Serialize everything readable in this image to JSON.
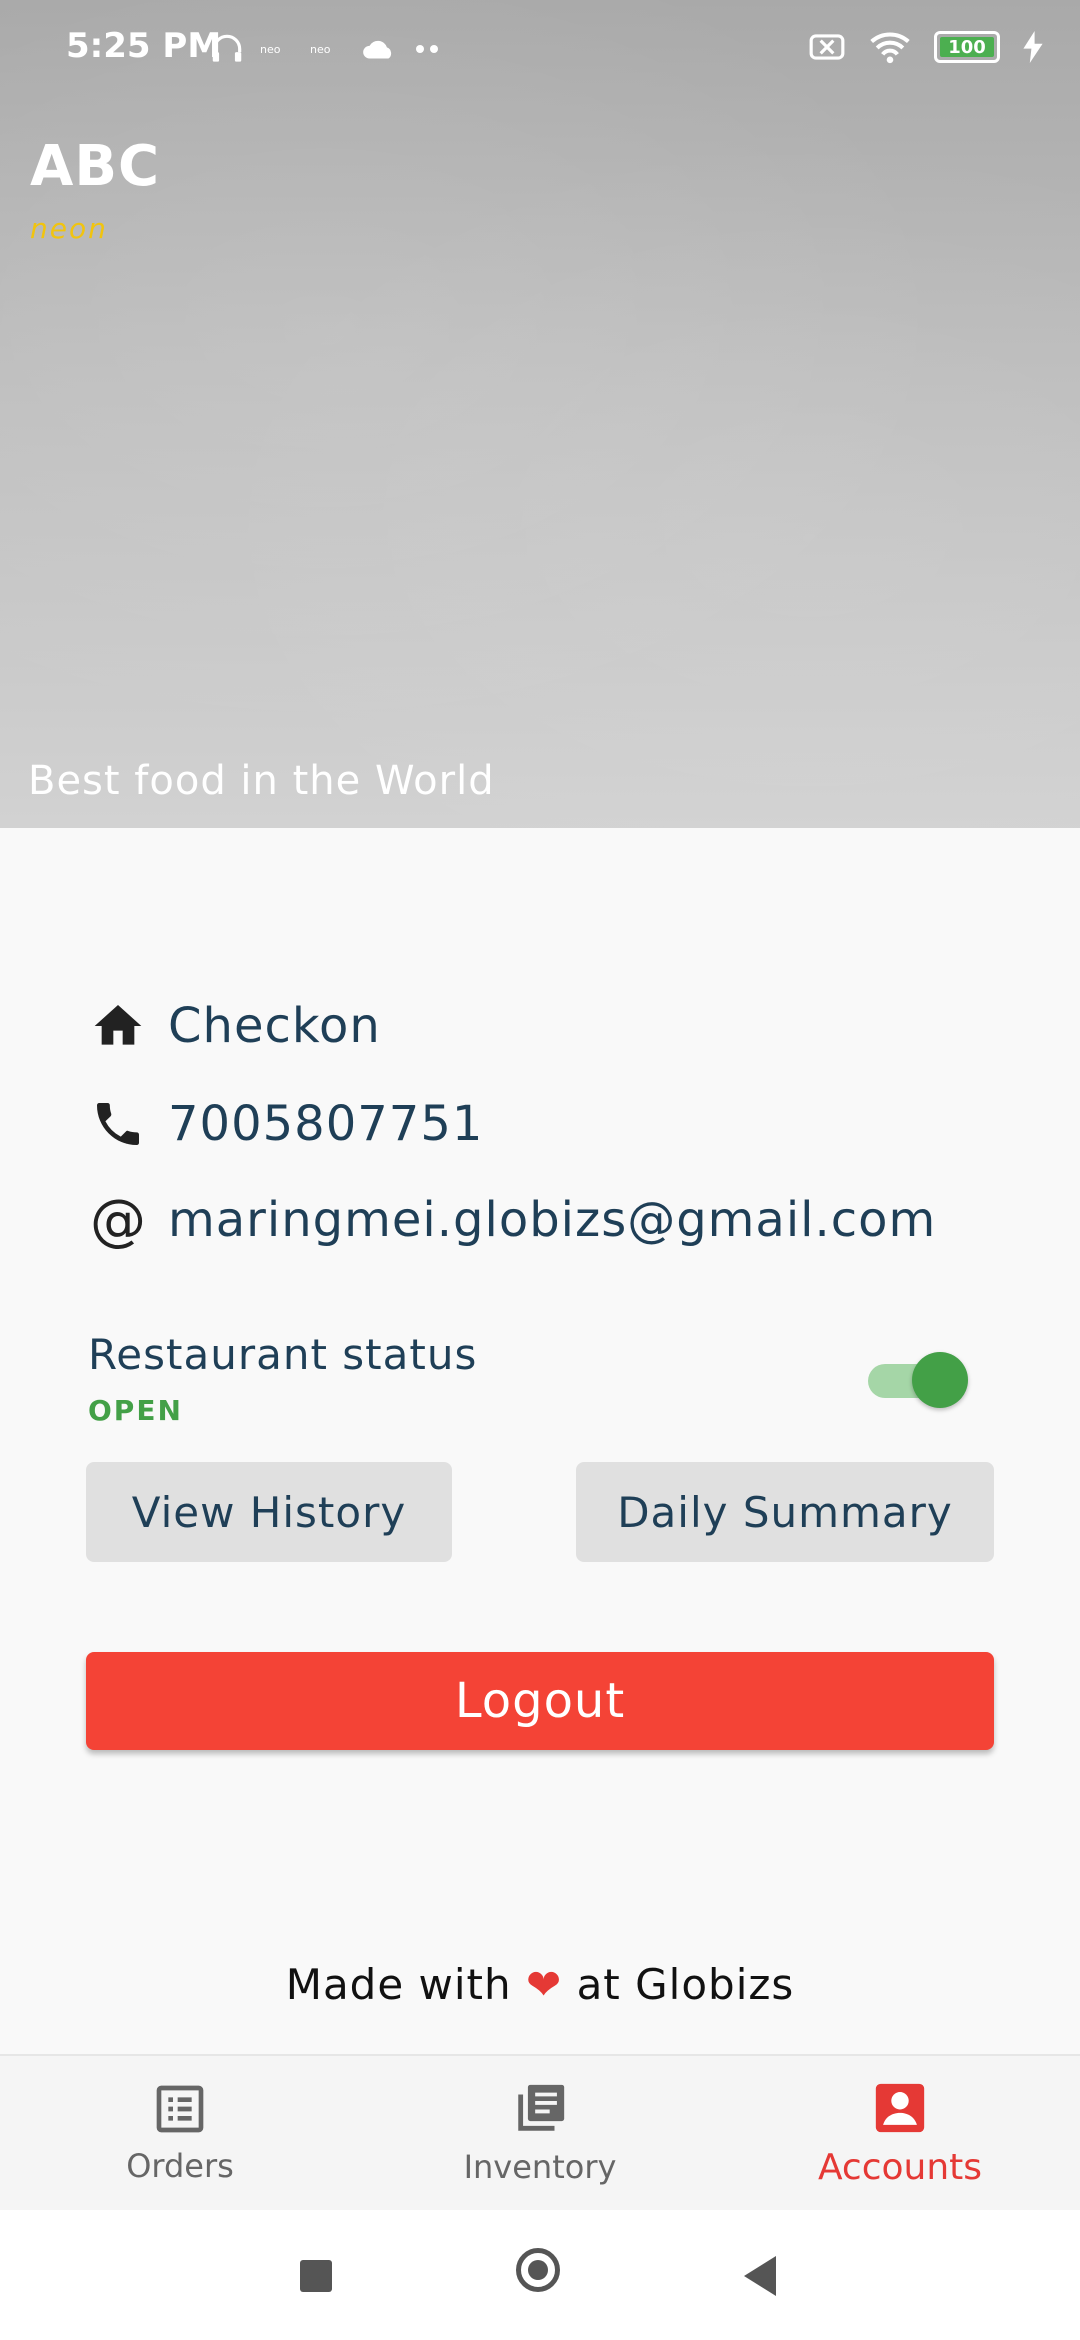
{
  "status_bar": {
    "time": "5:25 PM",
    "battery": "100",
    "icons": [
      "headset-icon",
      "neon-icon",
      "neon-icon",
      "cloud-icon",
      "more-dots-icon",
      "no-sim-icon",
      "wifi-icon",
      "battery-icon",
      "charging-icon"
    ]
  },
  "header": {
    "restaurant_name": "ABC",
    "brand": "neon",
    "tagline": "Best food in the World"
  },
  "profile": {
    "name": "Checkon",
    "phone": "7005807751",
    "email": "maringmei.globizs@gmail.com"
  },
  "restaurant_status": {
    "title": "Restaurant status",
    "value": "OPEN",
    "toggle_on": true
  },
  "actions": {
    "view_history": "View History",
    "daily_summary": "Daily Summary",
    "logout": "Logout"
  },
  "footer": {
    "made_with": "Made with",
    "heart": "❤",
    "at": "at Globizs"
  },
  "bottom_nav": {
    "items": [
      {
        "label": "Orders",
        "icon": "orders-list-icon",
        "active": false
      },
      {
        "label": "Inventory",
        "icon": "inventory-icon",
        "active": false
      },
      {
        "label": "Accounts",
        "icon": "account-icon",
        "active": true
      }
    ]
  },
  "colors": {
    "primary_text": "#1f3f57",
    "accent_red": "#f44336",
    "status_green": "#43a047",
    "active_tab": "#e53935"
  }
}
